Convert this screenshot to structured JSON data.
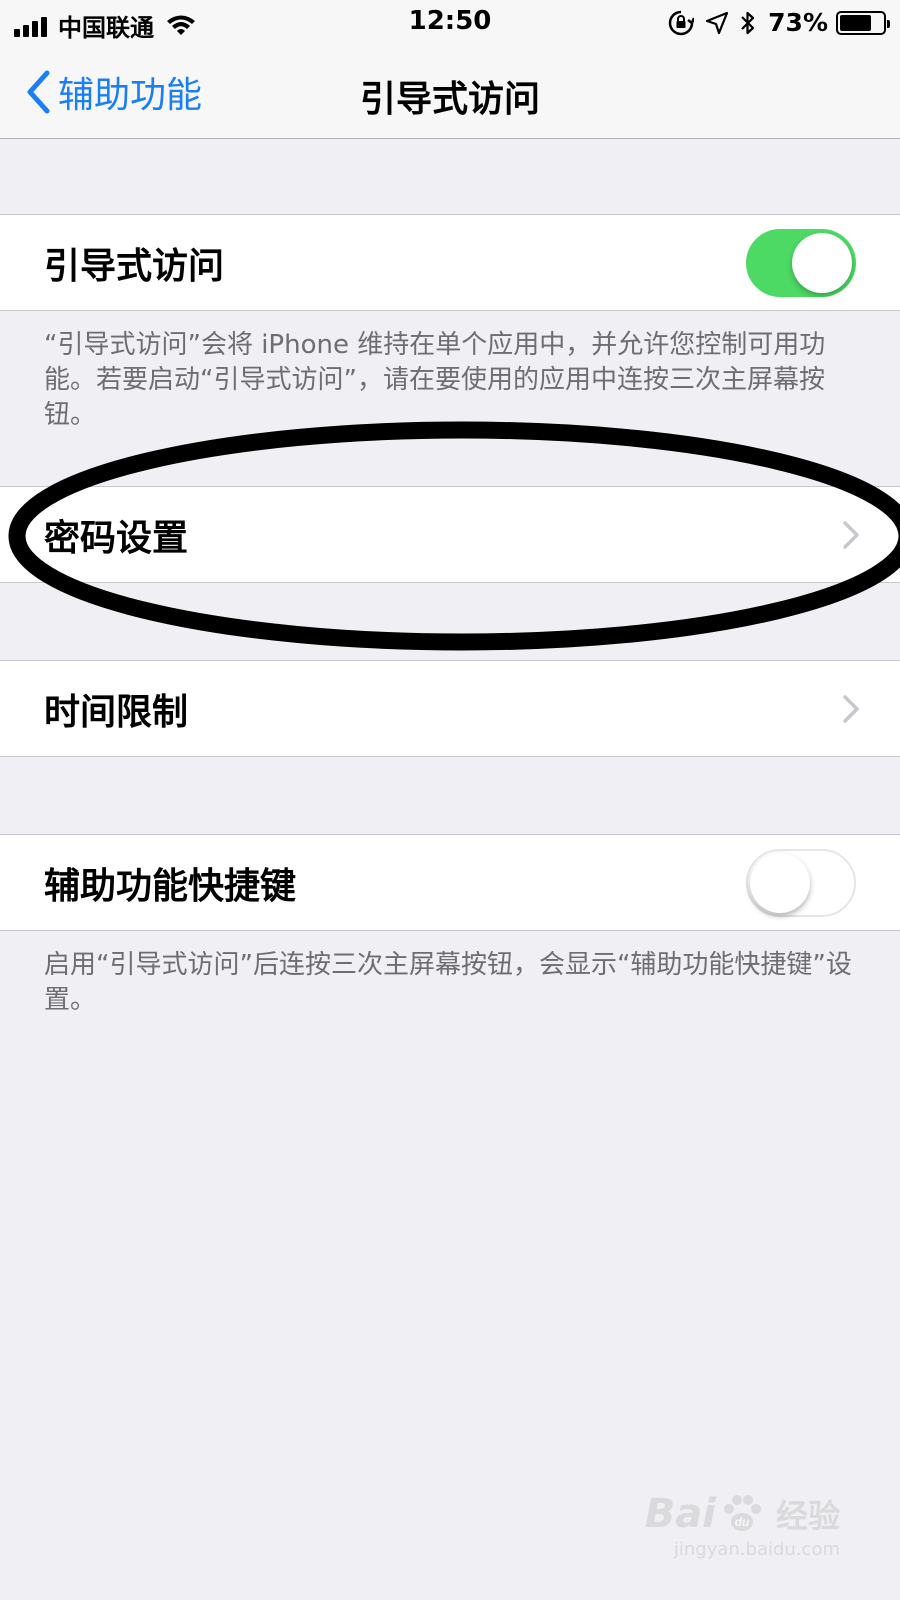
{
  "status_bar": {
    "carrier": "中国联通",
    "time": "12:50",
    "battery_percent": "73%",
    "battery_level": 0.73
  },
  "nav": {
    "back_label": "辅助功能",
    "title": "引导式访问"
  },
  "guided_access": {
    "label": "引导式访问",
    "enabled": true,
    "footer": "“引导式访问”会将 iPhone 维持在单个应用中，并允许您控制可用功能。若要启动“引导式访问”，请在要使用的应用中连按三次主屏幕按钮。"
  },
  "passcode_settings": {
    "label": "密码设置"
  },
  "time_limits": {
    "label": "时间限制"
  },
  "accessibility_shortcut": {
    "label": "辅助功能快捷键",
    "enabled": false,
    "footer": "启用“引导式访问”后连按三次主屏幕按钮，会显示“辅助功能快捷键”设置。"
  },
  "watermark": {
    "brand_left": "Bai",
    "brand_right": "经验",
    "url": "jingyan.baidu.com"
  },
  "colors": {
    "accent": "#1a7ef6",
    "toggle_on": "#4cd964",
    "background": "#efeff4",
    "annotation": "#000000"
  }
}
